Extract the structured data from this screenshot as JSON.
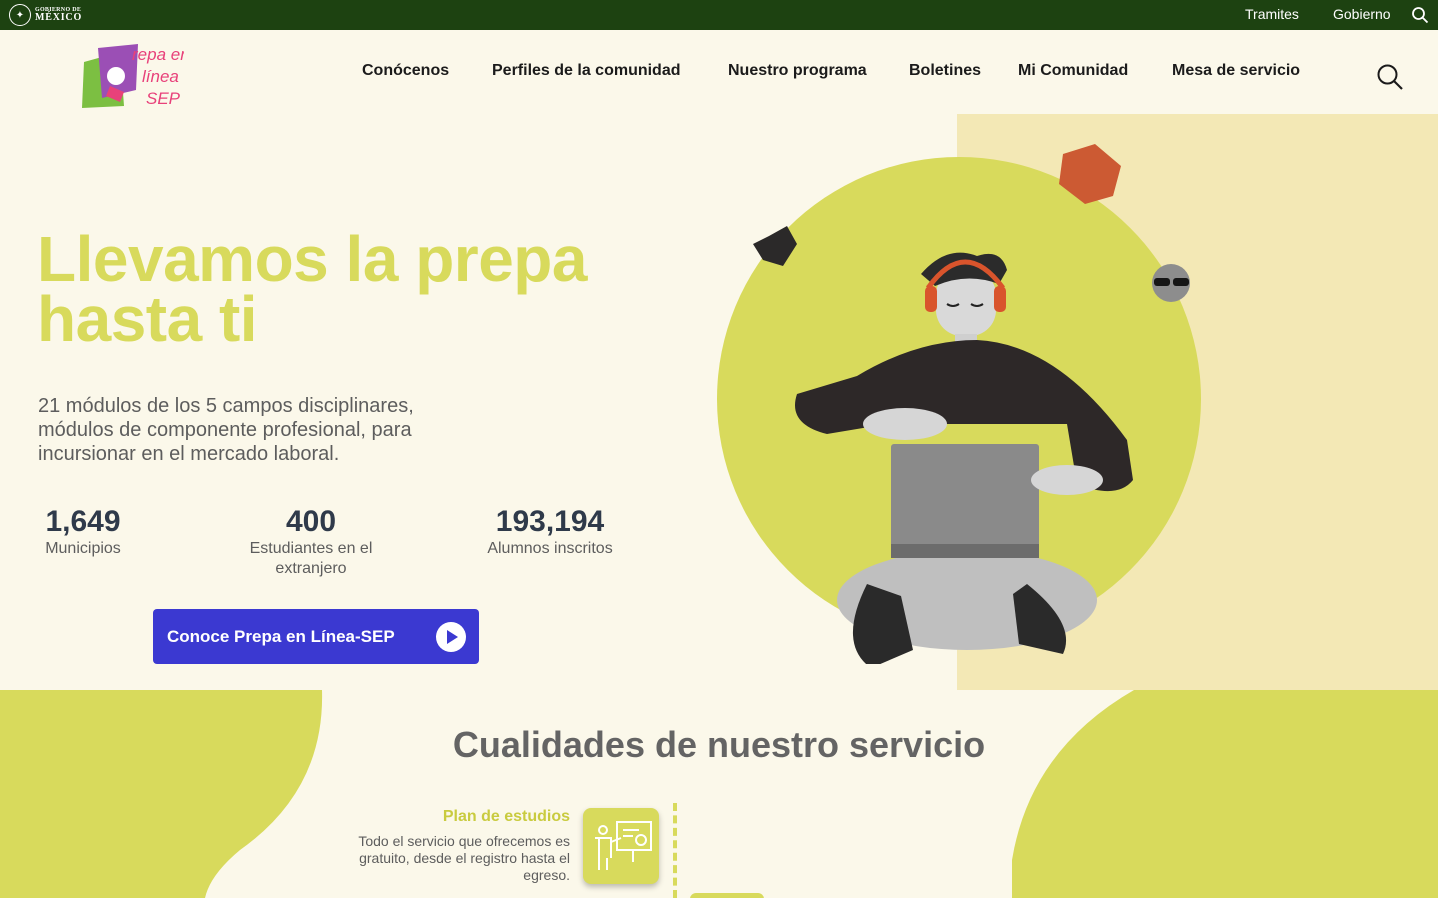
{
  "gov_bar": {
    "logo_line1": "GOBIERNO DE",
    "logo_line2": "MÉXICO",
    "links": [
      "Tramites",
      "Gobierno"
    ],
    "search_icon": "search-icon"
  },
  "header": {
    "logo_text": [
      "Prepa en",
      "Línea",
      "SEP"
    ],
    "nav": [
      "Conócenos",
      "Perfiles de la comunidad",
      "Nuestro programa",
      "Boletines",
      "Mi Comunidad",
      "Mesa de servicio"
    ],
    "search_icon": "search-icon"
  },
  "hero": {
    "title": "Llevamos la prepa hasta ti",
    "description": "21 módulos de los 5 campos disciplinares, módulos de componente profesional, para incursionar en el mercado laboral.",
    "stats": [
      {
        "value": "1,649",
        "label": "Municipios"
      },
      {
        "value": "400",
        "label": "Estudiantes en el extranjero"
      },
      {
        "value": "193,194",
        "label": "Alumnos inscritos"
      }
    ],
    "cta_label": "Conoce Prepa en Línea-SEP",
    "cta_icon": "play-circle-icon"
  },
  "qualities": {
    "title": "Cualidades de nuestro servicio",
    "feature": {
      "title": "Plan de estudios",
      "text": "Todo el servicio que ofrecemos es gratuito, desde el registro hasta el egreso.",
      "icon": "teacher-board-icon"
    }
  },
  "colors": {
    "gov_green": "#1d4211",
    "lime": "#d8da5c",
    "cream": "#fbf8ea",
    "panel": "#f3e8b5",
    "cta_blue": "#3b39d1",
    "logo_green": "#7cbf42",
    "logo_purple": "#9b4fb5",
    "logo_pink": "#e8417a"
  }
}
